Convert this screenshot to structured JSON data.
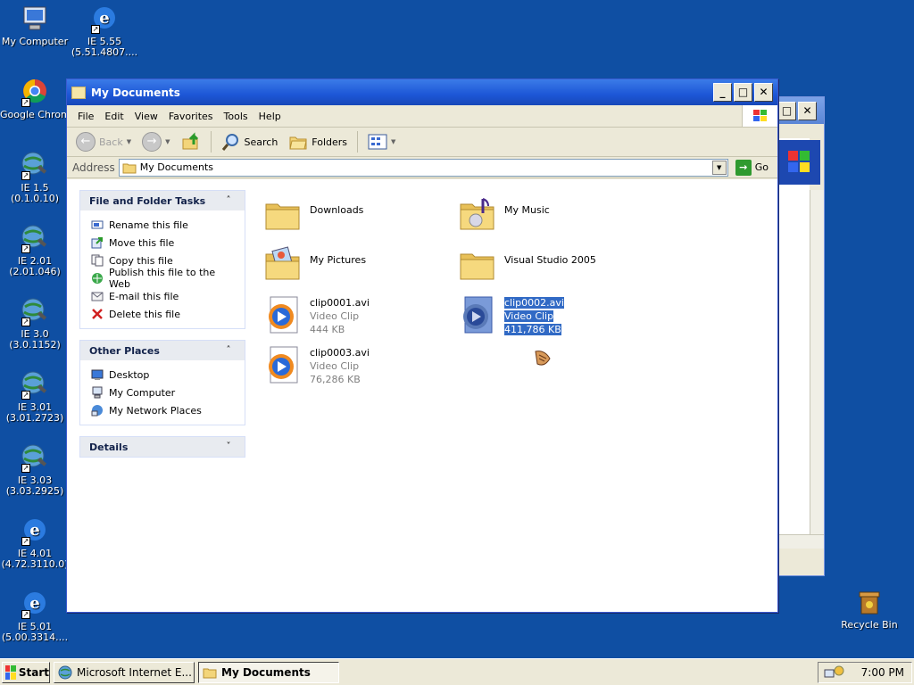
{
  "desktop": {
    "icons": [
      {
        "label": "My Computer",
        "icon": "my-computer-icon"
      },
      {
        "label": "IE 5.55\n(5.51.4807....",
        "icon": "ie-icon"
      },
      {
        "label": "Google Chrome",
        "icon": "chrome-icon"
      },
      {
        "label": "IE 1.5\n(0.1.0.10)",
        "icon": "ie-old-icon"
      },
      {
        "label": "IE 2.01\n(2.01.046)",
        "icon": "ie-old-icon"
      },
      {
        "label": "IE 3.0\n(3.0.1152)",
        "icon": "ie-old-icon"
      },
      {
        "label": "IE 3.01\n(3.01.2723)",
        "icon": "ie-old-icon"
      },
      {
        "label": "IE 3.03\n(3.03.2925)",
        "icon": "ie-old-icon"
      },
      {
        "label": "IE 4.01\n(4.72.3110.0)",
        "icon": "ie-icon"
      },
      {
        "label": "IE 5.01\n(5.00.3314....",
        "icon": "ie-icon"
      },
      {
        "label": "Recycle Bin",
        "icon": "recycle-bin-icon"
      }
    ]
  },
  "window": {
    "title": "My Documents",
    "menu": [
      "File",
      "Edit",
      "View",
      "Favorites",
      "Tools",
      "Help"
    ],
    "toolbar": {
      "back": "Back",
      "search": "Search",
      "folders": "Folders"
    },
    "address": {
      "label": "Address",
      "value": "My Documents",
      "go": "Go"
    }
  },
  "taskpane": {
    "file_tasks": {
      "title": "File and Folder Tasks",
      "toggle": "˄",
      "items": [
        {
          "label": "Rename this file",
          "icon": "rename-icon"
        },
        {
          "label": "Move this file",
          "icon": "move-icon"
        },
        {
          "label": "Copy this file",
          "icon": "copy-icon"
        },
        {
          "label": "Publish this file to the Web",
          "icon": "publish-icon"
        },
        {
          "label": "E-mail this file",
          "icon": "email-icon"
        },
        {
          "label": "Delete this file",
          "icon": "delete-icon"
        }
      ]
    },
    "other_places": {
      "title": "Other Places",
      "toggle": "˄",
      "items": [
        {
          "label": "Desktop",
          "icon": "desktop-icon"
        },
        {
          "label": "My Computer",
          "icon": "my-computer-icon"
        },
        {
          "label": "My Network Places",
          "icon": "network-icon"
        }
      ]
    },
    "details": {
      "title": "Details",
      "toggle": "˅"
    }
  },
  "files": [
    {
      "name": "Downloads",
      "type": "",
      "size": "",
      "icon": "folder-icon"
    },
    {
      "name": "My Music",
      "type": "",
      "size": "",
      "icon": "music-folder-icon"
    },
    {
      "name": "My Pictures",
      "type": "",
      "size": "",
      "icon": "pictures-folder-icon"
    },
    {
      "name": "Visual Studio 2005",
      "type": "",
      "size": "",
      "icon": "folder-icon"
    },
    {
      "name": "clip0001.avi",
      "type": "Video Clip",
      "size": "444 KB",
      "icon": "video-file-icon"
    },
    {
      "name": "clip0002.avi",
      "type": "Video Clip",
      "size": "411,786 KB",
      "icon": "video-file-icon",
      "selected": true
    },
    {
      "name": "clip0003.avi",
      "type": "Video Clip",
      "size": "76,286 KB",
      "icon": "video-file-icon"
    }
  ],
  "taskbar": {
    "start": "Start",
    "tasks": [
      "Microsoft Internet E...",
      "My Documents"
    ],
    "clock": "7:00 PM"
  },
  "colors": {
    "desktop": "#0f4fa3",
    "titlebar": "#1c56d6",
    "selection": "#316ac5",
    "folder": "#f3d57a"
  }
}
